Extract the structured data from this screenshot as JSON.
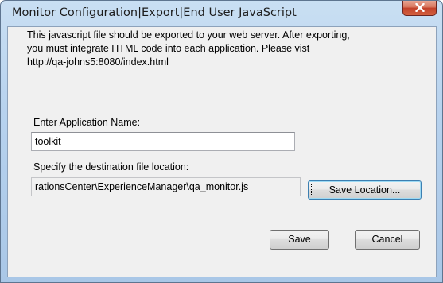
{
  "window": {
    "title": "Monitor Configuration|Export|End User JavaScript"
  },
  "message": {
    "lines": [
      "This javascript file should be exported to your web server.  After exporting,",
      "you must integrate HTML code into each application.  Please vist",
      "http://qa-johns5:8080/index.html"
    ]
  },
  "app_name": {
    "label": "Enter Application Name:",
    "value": "toolkit"
  },
  "destination": {
    "label": "Specify the destination file location:",
    "value": "rationsCenter\\ExperienceManager\\qa_monitor.js",
    "save_location_label": "Save Location..."
  },
  "buttons": {
    "save_label": "Save",
    "cancel_label": "Cancel"
  },
  "icons": {
    "close": "close-icon"
  }
}
